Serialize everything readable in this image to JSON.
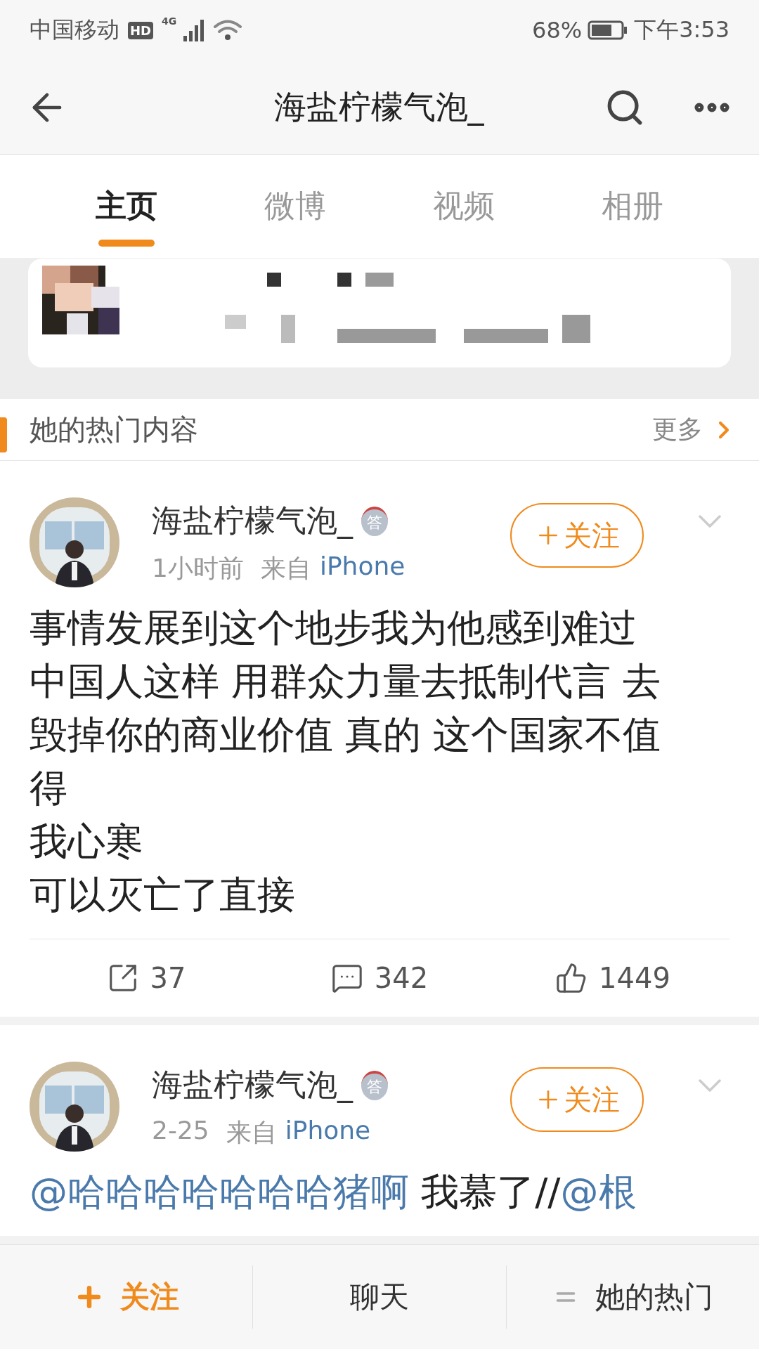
{
  "status_bar": {
    "carrier": "中国移动",
    "hd": "HD",
    "network": "4G",
    "battery": "68%",
    "time": "下午3:53"
  },
  "header": {
    "title": "海盐柠檬气泡_"
  },
  "tabs": [
    {
      "label": "主页",
      "selected": true
    },
    {
      "label": "微博",
      "selected": false
    },
    {
      "label": "视频",
      "selected": false
    },
    {
      "label": "相册",
      "selected": false
    }
  ],
  "hot_section": {
    "title": "她的热门内容",
    "more": "更多"
  },
  "posts": [
    {
      "author": "海盐柠檬气泡_",
      "badge": "答",
      "time": "1小时前",
      "source_prefix": "来自",
      "source": "iPhone",
      "follow": "关注",
      "paragraphs": [
        [
          {
            "kind": "text",
            "text": "事情发展到这个地步我为他感到难过中国人这样 用群众力量去抵制代言 去毁掉你的商业价值 真的 这个国家不值得"
          }
        ],
        [
          {
            "kind": "text",
            "text": "我心寒"
          }
        ],
        [
          {
            "kind": "text",
            "text": "可以灭亡了直接"
          }
        ]
      ],
      "stats": {
        "reposts": "37",
        "comments": "342",
        "likes": "1449"
      }
    },
    {
      "author": "海盐柠檬气泡_",
      "badge": "答",
      "time": "2-25",
      "source_prefix": "来自",
      "source": "iPhone",
      "follow": "关注",
      "paragraphs": [
        [
          {
            "kind": "mention",
            "text": "@哈哈哈哈哈哈哈猪啊"
          },
          {
            "kind": "text",
            "text": " 我慕了//"
          },
          {
            "kind": "mention",
            "text": "@根"
          }
        ]
      ]
    }
  ],
  "bottom_bar": [
    {
      "kind": "follow",
      "label": "关注"
    },
    {
      "kind": "chat",
      "label": "聊天"
    },
    {
      "kind": "menu",
      "label": "她的热门"
    }
  ]
}
